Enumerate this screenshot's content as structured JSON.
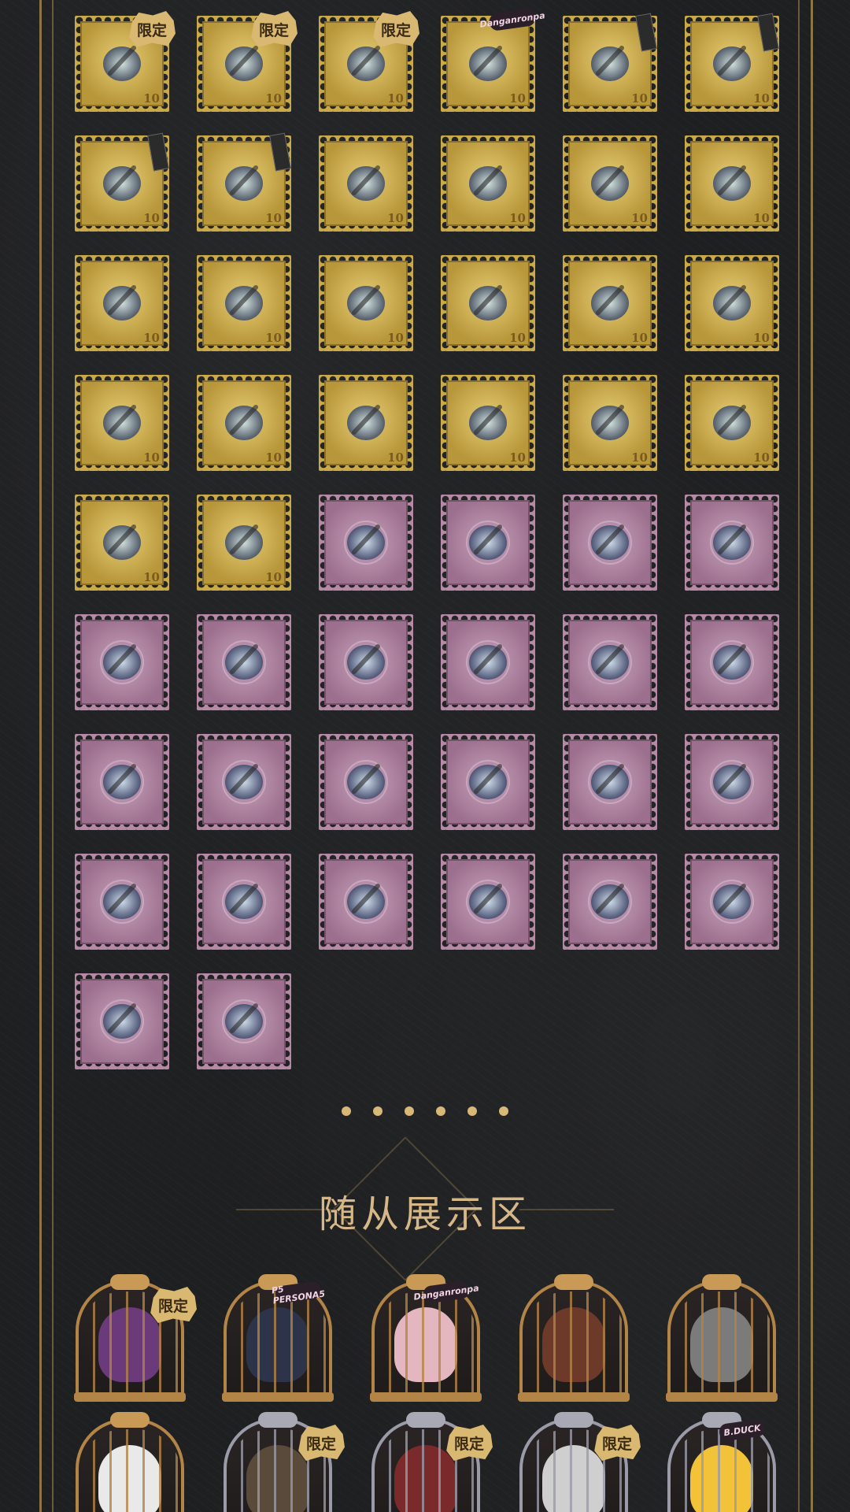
{
  "section": {
    "title": "随从展示区"
  },
  "pagination": {
    "dot_count": 6
  },
  "items": [
    {
      "type": "gold",
      "badge": "限定"
    },
    {
      "type": "gold",
      "badge": "限定"
    },
    {
      "type": "gold",
      "badge": "限定"
    },
    {
      "type": "gold",
      "logo": "Danganronpa"
    },
    {
      "type": "gold",
      "tag": true
    },
    {
      "type": "gold",
      "tag": true
    },
    {
      "type": "gold",
      "tag": true
    },
    {
      "type": "gold",
      "tag": true
    },
    {
      "type": "gold"
    },
    {
      "type": "gold"
    },
    {
      "type": "gold"
    },
    {
      "type": "gold"
    },
    {
      "type": "gold"
    },
    {
      "type": "gold"
    },
    {
      "type": "gold"
    },
    {
      "type": "gold"
    },
    {
      "type": "gold"
    },
    {
      "type": "gold"
    },
    {
      "type": "gold"
    },
    {
      "type": "gold"
    },
    {
      "type": "gold"
    },
    {
      "type": "gold"
    },
    {
      "type": "gold"
    },
    {
      "type": "gold"
    },
    {
      "type": "gold"
    },
    {
      "type": "gold"
    },
    {
      "type": "purple"
    },
    {
      "type": "purple"
    },
    {
      "type": "purple"
    },
    {
      "type": "purple"
    },
    {
      "type": "purple"
    },
    {
      "type": "purple"
    },
    {
      "type": "purple"
    },
    {
      "type": "purple"
    },
    {
      "type": "purple"
    },
    {
      "type": "purple"
    },
    {
      "type": "purple"
    },
    {
      "type": "purple"
    },
    {
      "type": "purple"
    },
    {
      "type": "purple"
    },
    {
      "type": "purple"
    },
    {
      "type": "purple"
    },
    {
      "type": "purple"
    },
    {
      "type": "purple"
    },
    {
      "type": "purple"
    },
    {
      "type": "purple"
    },
    {
      "type": "purple"
    },
    {
      "type": "purple"
    },
    {
      "type": "purple"
    },
    {
      "type": "purple"
    }
  ],
  "item_denomination": "10",
  "companions": [
    {
      "cage": "gold",
      "badge": "限定",
      "pet_color": "#6a3a7a"
    },
    {
      "cage": "gold",
      "logo": "P5 PERSONA5",
      "pet_color": "#2d3348"
    },
    {
      "cage": "gold",
      "logo": "Danganronpa",
      "pet_color": "#e4b6bf"
    },
    {
      "cage": "gold",
      "pet_color": "#6d3a2a"
    },
    {
      "cage": "gold",
      "pet_color": "#7b7b7b"
    },
    {
      "cage": "gold",
      "pet_color": "#e9e9e9"
    },
    {
      "cage": "silver",
      "badge": "限定",
      "pet_color": "#5a4a3a"
    },
    {
      "cage": "silver",
      "badge": "限定",
      "pet_color": "#7a2a2a"
    },
    {
      "cage": "silver",
      "badge": "限定",
      "pet_color": "#cfcfcf"
    },
    {
      "cage": "silver",
      "logo": "B.DUCK",
      "pet_color": "#f2c338"
    }
  ],
  "colors": {
    "gold_frame": "#c9a948",
    "purple_frame": "#b68aa6",
    "accent": "#d6b788"
  }
}
